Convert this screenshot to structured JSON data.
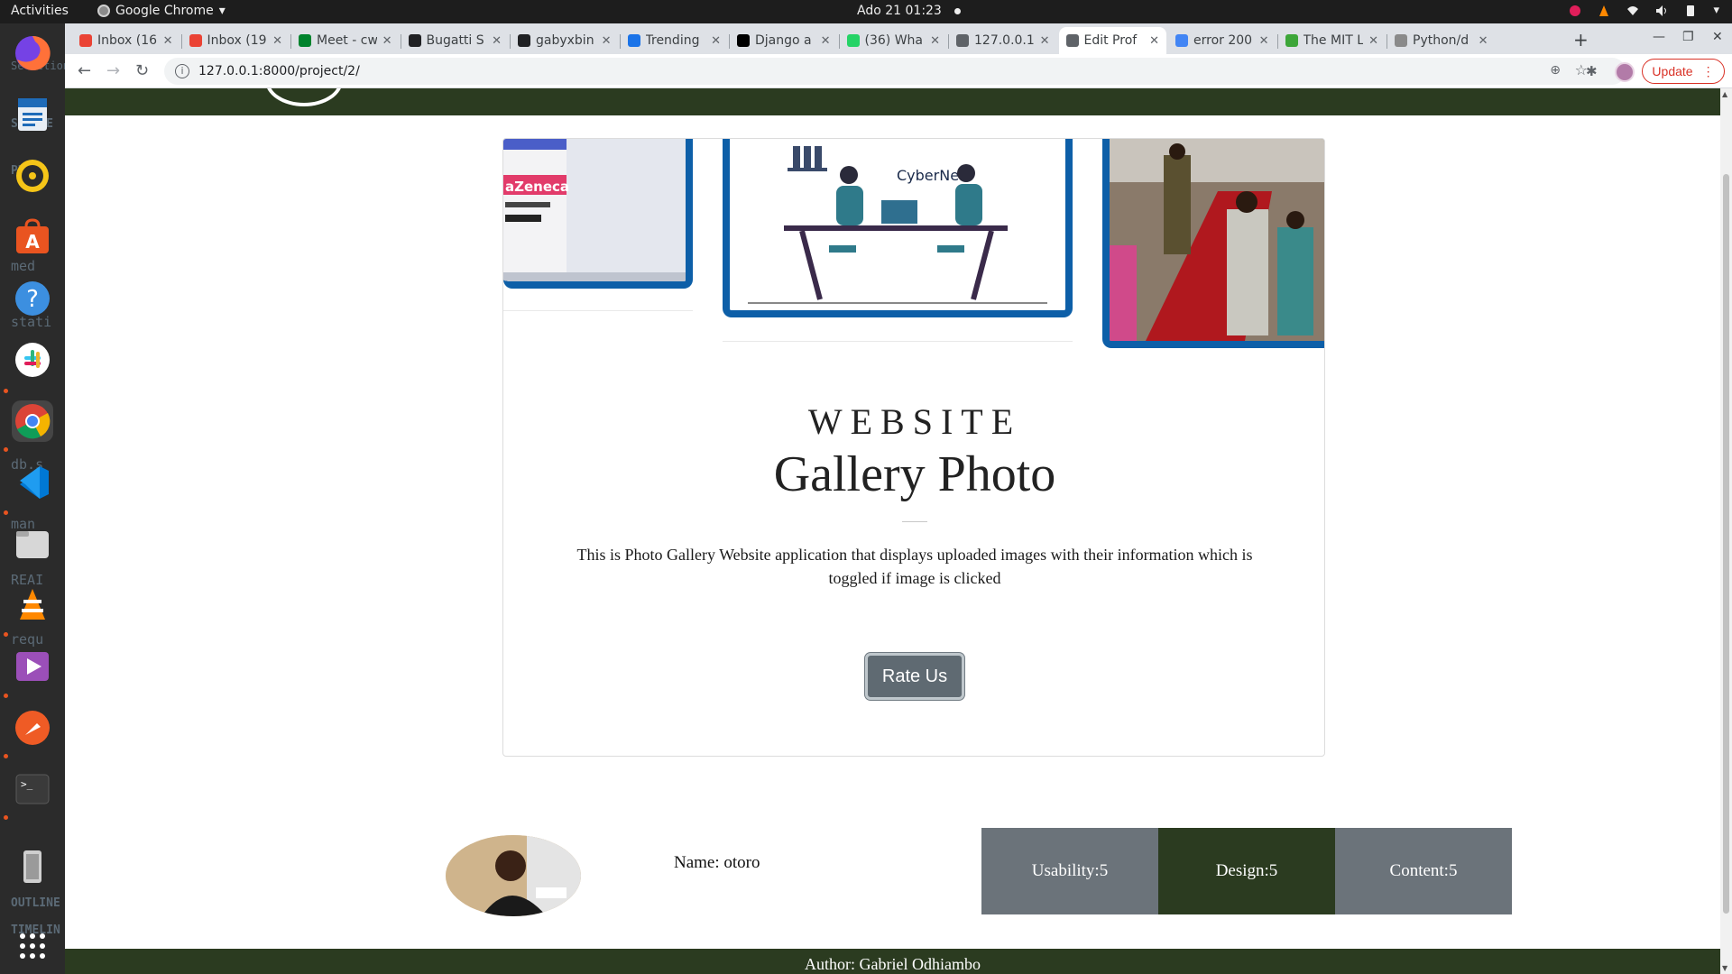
{
  "topbar": {
    "activities": "Activities",
    "app_name": "Google Chrome",
    "clock": "Ado 21  01:23"
  },
  "dock": {
    "ghost_labels": [
      "Selection",
      "SOURCE",
      "PHOTO",
      "med",
      "stati",
      "db.s",
      "man",
      "REAI",
      "requ",
      "OUTLINE",
      "TIMELIN"
    ]
  },
  "tabs": [
    {
      "title": "Inbox (16",
      "favicon": "gmail-icon",
      "color": "#ea4335"
    },
    {
      "title": "Inbox (19",
      "favicon": "gmail-icon",
      "color": "#ea4335"
    },
    {
      "title": "Meet - cw",
      "favicon": "meet-icon",
      "color": "#00832d"
    },
    {
      "title": "Bugatti S",
      "favicon": "wikipedia-icon",
      "color": "#202124"
    },
    {
      "title": "gabyxbin",
      "favicon": "github-icon",
      "color": "#202124"
    },
    {
      "title": "Trending",
      "favicon": "codecov-icon",
      "color": "#1a73e8"
    },
    {
      "title": "Django a",
      "favicon": "dev-icon",
      "color": "#000000"
    },
    {
      "title": "(36) Wha",
      "favicon": "whatsapp-icon",
      "color": "#25d366"
    },
    {
      "title": "127.0.0.1",
      "favicon": "globe-icon",
      "color": "#5f6368"
    },
    {
      "title": "Edit Prof",
      "favicon": "globe-icon",
      "color": "#5f6368",
      "active": true
    },
    {
      "title": "error 200",
      "favicon": "google-icon",
      "color": "#4285f4"
    },
    {
      "title": "The MIT L",
      "favicon": "opensource-icon",
      "color": "#3da639"
    },
    {
      "title": "Python/d",
      "favicon": "pin-icon",
      "color": "#8a8a8a"
    }
  ],
  "toolbar": {
    "url": "127.0.0.1:8000/project/2/",
    "update_label": "Update"
  },
  "page": {
    "gallery_images": [
      "vaccine-vial-photo",
      "cybernet-illustration",
      "dignitaries-red-carpet-photo"
    ],
    "cybernet_caption": "CyberNet",
    "vaccine_text": "aZeneca",
    "kicker": "WEBSITE",
    "title": "Gallery Photo",
    "description": "This is Photo Gallery Website application that displays uploaded images with their information which is toggled if image is clicked",
    "rate_button": "Rate Us",
    "rating": {
      "name": "Name: otoro",
      "usability": "Usability:5",
      "design": "Design:5",
      "content": "Content:5"
    },
    "footer": "Author: Gabriel Odhiambo"
  },
  "colors": {
    "brand_dark_green": "#2b3b20",
    "slate": "#6b737a",
    "frame_blue": "#0d5fa8"
  }
}
